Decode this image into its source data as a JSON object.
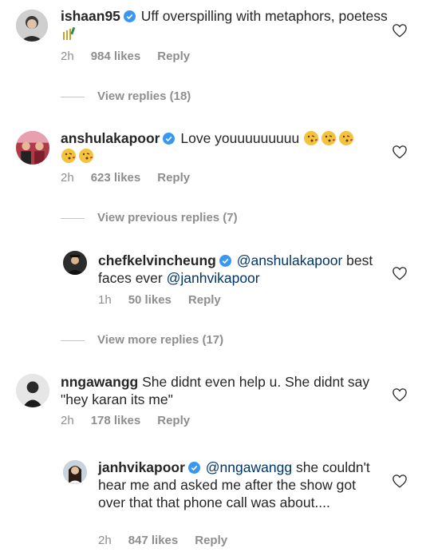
{
  "colors": {
    "text": "#262626",
    "meta": "#8e8e8e",
    "mention": "#003569",
    "verified": "#3897f0"
  },
  "comments": [
    {
      "username": "ishaan95",
      "verified": true,
      "text": "Uff overspilling with metaphors, poetess",
      "emoji": "cricket-bat-emoji",
      "time": "2h",
      "likes": "984 likes",
      "reply": "Reply"
    },
    {
      "username": "anshulakapoor",
      "verified": true,
      "text": "Love youuuuuuuuu",
      "emoji": "kissing-face-emoji",
      "time": "2h",
      "likes": "623 likes",
      "reply": "Reply"
    },
    {
      "username": "chefkelvincheung",
      "verified": true,
      "mention": "@anshulakapoor",
      "text": "best faces ever",
      "mention2": "@janhvikapoor",
      "time": "1h",
      "likes": "50 likes",
      "reply": "Reply"
    },
    {
      "username": "nngawangg",
      "verified": false,
      "text": "She didnt even help u. She didnt say \"hey karan its me\"",
      "time": "2h",
      "likes": "178 likes",
      "reply": "Reply"
    },
    {
      "username": "janhvikapoor",
      "verified": true,
      "mention": "@nngawangg",
      "text": "she couldn't hear me and asked me after the show got over that that phone call was about....",
      "time": "2h",
      "likes": "847 likes",
      "reply": "Reply"
    }
  ],
  "view_replies": [
    "View replies (18)",
    "View previous replies (7)",
    "View more replies (17)"
  ]
}
